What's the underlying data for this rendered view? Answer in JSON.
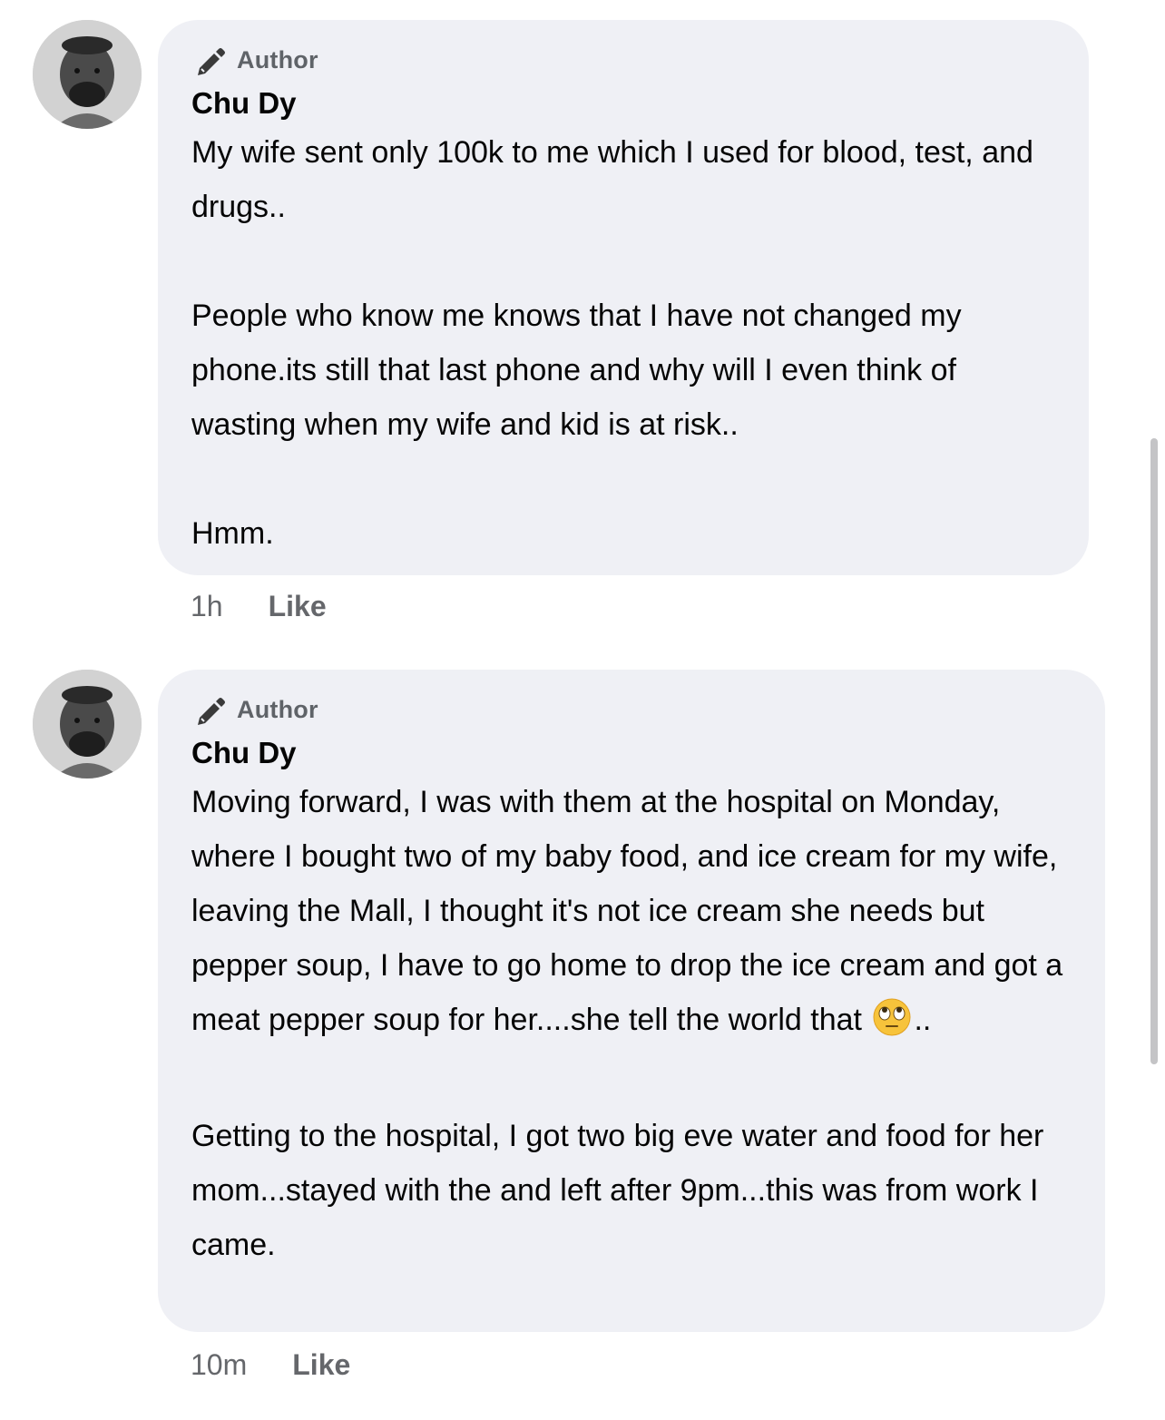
{
  "comments": [
    {
      "badge": "Author",
      "author": "Chu Dy",
      "paragraphs": [
        "My wife sent only 100k to me which I used for blood, test, and drugs..",
        "People who know me knows that I have not changed my phone.its still that last phone and why will I even think of wasting when my wife and kid is at risk..",
        "Hmm."
      ],
      "time": "1h",
      "like_label": "Like"
    },
    {
      "badge": "Author",
      "author": "Chu Dy",
      "paragraph1_text": "Moving forward, I was with them at the hospital on Monday, where I bought two of my baby food, and ice cream for my wife, leaving the Mall, I thought it's not ice cream she needs but pepper soup, I have to go home to drop the ice cream and got a meat pepper soup for her....she tell the world that",
      "paragraph1_tail": "..",
      "emoji": "eye-roll-emoji",
      "paragraph2": "Getting to the hospital, I got two big eve water and food for her mom...stayed with the and left after 9pm...this was from work I came.",
      "time": "10m",
      "like_label": "Like"
    }
  ],
  "colors": {
    "bubble_bg": "#eff0f5",
    "meta_text": "#65676b",
    "badge_text": "#5f6368"
  }
}
